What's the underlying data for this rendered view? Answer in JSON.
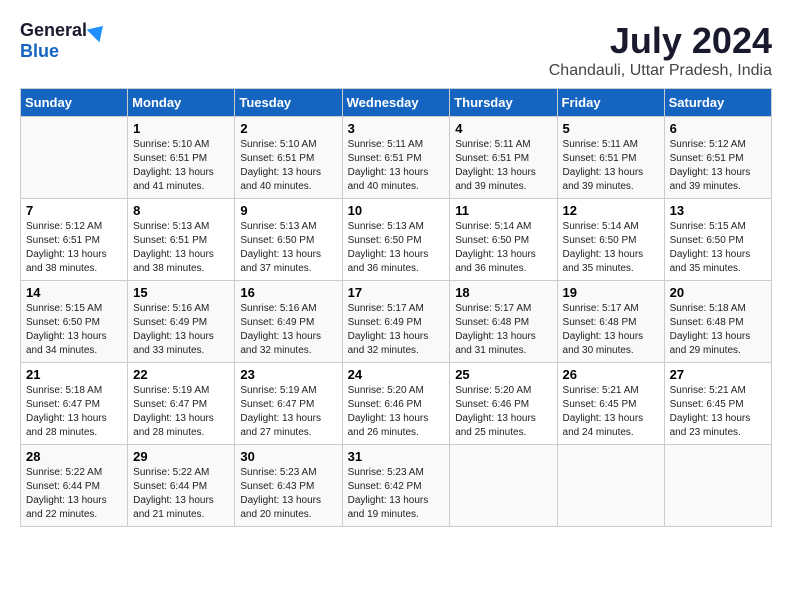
{
  "header": {
    "logo_general": "General",
    "logo_blue": "Blue",
    "month_year": "July 2024",
    "location": "Chandauli, Uttar Pradesh, India"
  },
  "days_of_week": [
    "Sunday",
    "Monday",
    "Tuesday",
    "Wednesday",
    "Thursday",
    "Friday",
    "Saturday"
  ],
  "weeks": [
    [
      {
        "day": "",
        "info": ""
      },
      {
        "day": "1",
        "info": "Sunrise: 5:10 AM\nSunset: 6:51 PM\nDaylight: 13 hours\nand 41 minutes."
      },
      {
        "day": "2",
        "info": "Sunrise: 5:10 AM\nSunset: 6:51 PM\nDaylight: 13 hours\nand 40 minutes."
      },
      {
        "day": "3",
        "info": "Sunrise: 5:11 AM\nSunset: 6:51 PM\nDaylight: 13 hours\nand 40 minutes."
      },
      {
        "day": "4",
        "info": "Sunrise: 5:11 AM\nSunset: 6:51 PM\nDaylight: 13 hours\nand 39 minutes."
      },
      {
        "day": "5",
        "info": "Sunrise: 5:11 AM\nSunset: 6:51 PM\nDaylight: 13 hours\nand 39 minutes."
      },
      {
        "day": "6",
        "info": "Sunrise: 5:12 AM\nSunset: 6:51 PM\nDaylight: 13 hours\nand 39 minutes."
      }
    ],
    [
      {
        "day": "7",
        "info": "Sunrise: 5:12 AM\nSunset: 6:51 PM\nDaylight: 13 hours\nand 38 minutes."
      },
      {
        "day": "8",
        "info": "Sunrise: 5:13 AM\nSunset: 6:51 PM\nDaylight: 13 hours\nand 38 minutes."
      },
      {
        "day": "9",
        "info": "Sunrise: 5:13 AM\nSunset: 6:50 PM\nDaylight: 13 hours\nand 37 minutes."
      },
      {
        "day": "10",
        "info": "Sunrise: 5:13 AM\nSunset: 6:50 PM\nDaylight: 13 hours\nand 36 minutes."
      },
      {
        "day": "11",
        "info": "Sunrise: 5:14 AM\nSunset: 6:50 PM\nDaylight: 13 hours\nand 36 minutes."
      },
      {
        "day": "12",
        "info": "Sunrise: 5:14 AM\nSunset: 6:50 PM\nDaylight: 13 hours\nand 35 minutes."
      },
      {
        "day": "13",
        "info": "Sunrise: 5:15 AM\nSunset: 6:50 PM\nDaylight: 13 hours\nand 35 minutes."
      }
    ],
    [
      {
        "day": "14",
        "info": "Sunrise: 5:15 AM\nSunset: 6:50 PM\nDaylight: 13 hours\nand 34 minutes."
      },
      {
        "day": "15",
        "info": "Sunrise: 5:16 AM\nSunset: 6:49 PM\nDaylight: 13 hours\nand 33 minutes."
      },
      {
        "day": "16",
        "info": "Sunrise: 5:16 AM\nSunset: 6:49 PM\nDaylight: 13 hours\nand 32 minutes."
      },
      {
        "day": "17",
        "info": "Sunrise: 5:17 AM\nSunset: 6:49 PM\nDaylight: 13 hours\nand 32 minutes."
      },
      {
        "day": "18",
        "info": "Sunrise: 5:17 AM\nSunset: 6:48 PM\nDaylight: 13 hours\nand 31 minutes."
      },
      {
        "day": "19",
        "info": "Sunrise: 5:17 AM\nSunset: 6:48 PM\nDaylight: 13 hours\nand 30 minutes."
      },
      {
        "day": "20",
        "info": "Sunrise: 5:18 AM\nSunset: 6:48 PM\nDaylight: 13 hours\nand 29 minutes."
      }
    ],
    [
      {
        "day": "21",
        "info": "Sunrise: 5:18 AM\nSunset: 6:47 PM\nDaylight: 13 hours\nand 28 minutes."
      },
      {
        "day": "22",
        "info": "Sunrise: 5:19 AM\nSunset: 6:47 PM\nDaylight: 13 hours\nand 28 minutes."
      },
      {
        "day": "23",
        "info": "Sunrise: 5:19 AM\nSunset: 6:47 PM\nDaylight: 13 hours\nand 27 minutes."
      },
      {
        "day": "24",
        "info": "Sunrise: 5:20 AM\nSunset: 6:46 PM\nDaylight: 13 hours\nand 26 minutes."
      },
      {
        "day": "25",
        "info": "Sunrise: 5:20 AM\nSunset: 6:46 PM\nDaylight: 13 hours\nand 25 minutes."
      },
      {
        "day": "26",
        "info": "Sunrise: 5:21 AM\nSunset: 6:45 PM\nDaylight: 13 hours\nand 24 minutes."
      },
      {
        "day": "27",
        "info": "Sunrise: 5:21 AM\nSunset: 6:45 PM\nDaylight: 13 hours\nand 23 minutes."
      }
    ],
    [
      {
        "day": "28",
        "info": "Sunrise: 5:22 AM\nSunset: 6:44 PM\nDaylight: 13 hours\nand 22 minutes."
      },
      {
        "day": "29",
        "info": "Sunrise: 5:22 AM\nSunset: 6:44 PM\nDaylight: 13 hours\nand 21 minutes."
      },
      {
        "day": "30",
        "info": "Sunrise: 5:23 AM\nSunset: 6:43 PM\nDaylight: 13 hours\nand 20 minutes."
      },
      {
        "day": "31",
        "info": "Sunrise: 5:23 AM\nSunset: 6:42 PM\nDaylight: 13 hours\nand 19 minutes."
      },
      {
        "day": "",
        "info": ""
      },
      {
        "day": "",
        "info": ""
      },
      {
        "day": "",
        "info": ""
      }
    ]
  ]
}
